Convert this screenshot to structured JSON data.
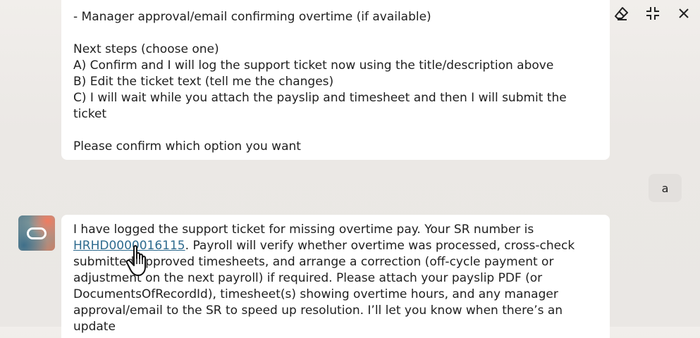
{
  "toolbar": {
    "icons": [
      "eraser-icon",
      "collapse-icon",
      "close-icon"
    ]
  },
  "messages": {
    "top": {
      "line_partial": "- Manager approval/email confirming overtime (if available)",
      "next_steps_title": "Next steps (choose one)",
      "option_a": "A) Confirm and I will log the support ticket now using the title/description above",
      "option_b": "B) Edit the ticket text (tell me the changes)",
      "option_c": "C) I will wait while you attach the payslip and timesheet and then I will submit the ticket",
      "confirm": "Please confirm which option you want"
    },
    "user": {
      "text": "a"
    },
    "bottom": {
      "line1": "I have logged the support ticket for missing overtime pay. Your SR number is",
      "sr_number": "HRHD0000016115",
      "line2_rest": ". Payroll will verify whether overtime was processed, cross-check",
      "line3": "submitted approved timesheets, and arrange a correction (off-cycle payment or",
      "line4": "adjustment on the next payroll) if required. Please attach your payslip PDF (or",
      "line5": "DocumentsOfRecordId), timesheet(s) showing overtime hours, and any manager",
      "line6": "approval/email to the SR to speed up resolution. I’ll let you know when there’s an update"
    }
  },
  "colors": {
    "link": "#2d6a8e",
    "bubble": "#ffffff",
    "user_bubble": "#e3e0dd",
    "background": "#ece9e6"
  }
}
